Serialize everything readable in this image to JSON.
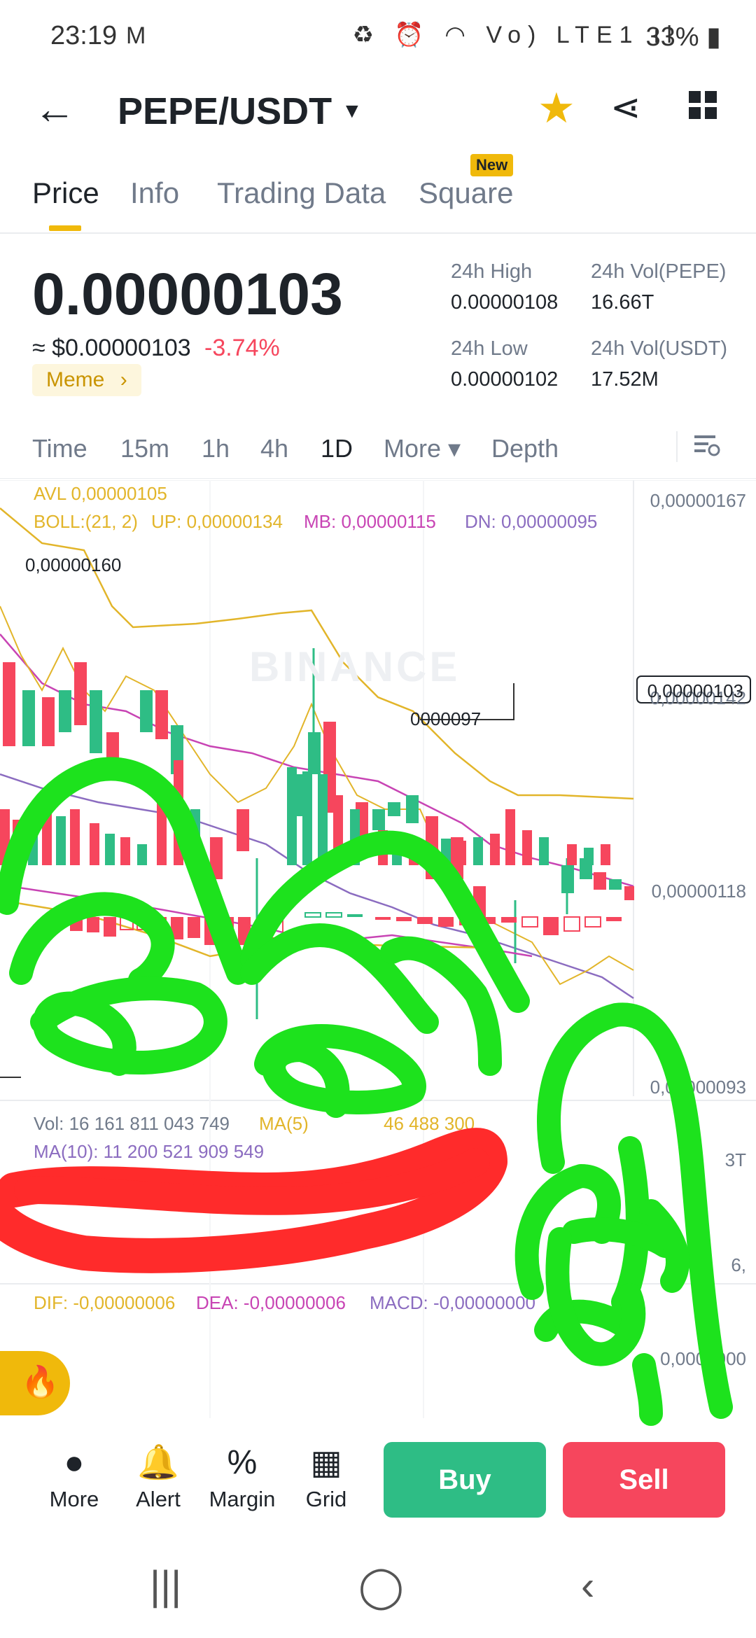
{
  "status_bar": {
    "time": "23:19",
    "mail_icon": "gmail-icon",
    "icons": "♻ ⏰ ◠ Vo) LTE1 ıl",
    "battery": "33% ▮"
  },
  "header": {
    "pair": "PEPE/USDT",
    "back_icon": "arrow-left-icon",
    "star_icon": "star-icon",
    "share_icon": "share-icon",
    "grid_icon": "grid-icon"
  },
  "tabs": [
    {
      "label": "Price"
    },
    {
      "label": "Info"
    },
    {
      "label": "Trading Data"
    },
    {
      "label": "Square"
    }
  ],
  "new_badge": "New",
  "price": {
    "last": "0.00000103",
    "usd": "≈ $0.00000103",
    "change": "-3.74%",
    "tag": "Meme",
    "tag_arrow": "›"
  },
  "stats": {
    "high_label": "24h High",
    "high_value": "0.00000108",
    "low_label": "24h Low",
    "low_value": "0.00000102",
    "vol_base_label": "24h Vol(PEPE)",
    "vol_base_value": "16.66T",
    "vol_quote_label": "24h Vol(USDT)",
    "vol_quote_value": "17.52M"
  },
  "timeframes": [
    {
      "label": "Time"
    },
    {
      "label": "15m"
    },
    {
      "label": "1h"
    },
    {
      "label": "4h"
    },
    {
      "label": "1D"
    },
    {
      "label": "More ▾"
    },
    {
      "label": "Depth"
    }
  ],
  "chart": {
    "avl": "AVL 0,00000105",
    "boll": "BOLL:(21, 2)",
    "up": "UP: 0,00000134",
    "mb": "MB: 0,00000115",
    "dn": "DN: 0,00000095",
    "high_marker": "0,00000160",
    "low_marker": "0000097",
    "watermark": "BINANCE",
    "axis": [
      "0,00000167",
      "0,00000142",
      "0,00000118",
      "0,00000093"
    ],
    "current_price": "0,00000103",
    "vol_line": "Vol: 16 161 811 043 749",
    "vol_ma5": "MA(5)",
    "vol_ma5_value": "46 488 300",
    "vol_ma10": "MA(10): 11 200 521 909 549",
    "vol_axis_top": "3T",
    "vol_axis_mid": "6,",
    "dif": "DIF: -0,00000006",
    "dea": "DEA: -0,00000006",
    "macd": "MACD: -0,00000000",
    "macd_axis": "0,0000000",
    "colors": {
      "up": "#2ebd85",
      "down": "#f6465d",
      "avl": "#e2b52a",
      "mb": "#c844b4",
      "dn": "#8b6cc0"
    }
  },
  "bottom": {
    "more": "More",
    "alert": "Alert",
    "margin": "Margin",
    "grid": "Grid",
    "buy": "Buy",
    "sell": "Sell"
  },
  "system_nav": {
    "recents": "|||",
    "home": "◯",
    "back": "‹"
  }
}
